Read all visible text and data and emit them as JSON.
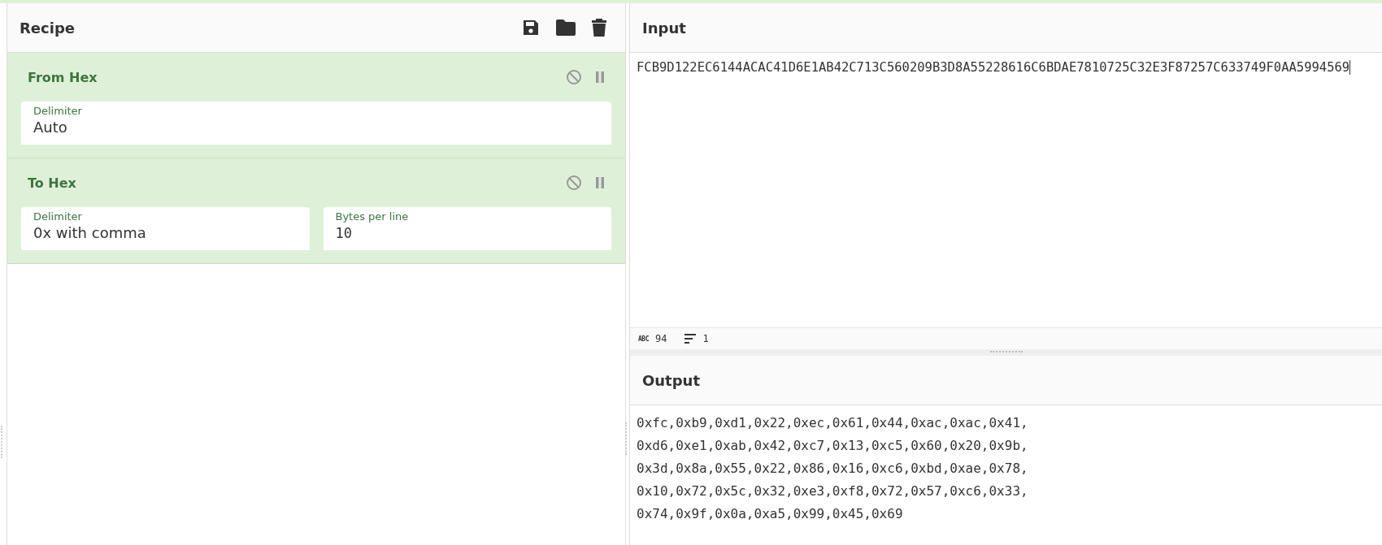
{
  "recipe": {
    "title": "Recipe",
    "operations": [
      {
        "name": "From Hex",
        "args": [
          {
            "label": "Delimiter",
            "value": "Auto",
            "kind": "text"
          }
        ]
      },
      {
        "name": "To Hex",
        "args": [
          {
            "label": "Delimiter",
            "value": "0x with comma",
            "kind": "text"
          },
          {
            "label": "Bytes per line",
            "value": "10",
            "kind": "number"
          }
        ]
      }
    ]
  },
  "input": {
    "title": "Input",
    "text": "FCB9D122EC6144ACAC41D6E1AB42C713C560209B3D8A55228616C6BDAE7810725C32E3F87257C633749F0AA5994569",
    "status": {
      "length_icon": "ABC",
      "length": "94",
      "lines": "1"
    }
  },
  "output": {
    "title": "Output",
    "lines": [
      "0xfc,0xb9,0xd1,0x22,0xec,0x61,0x44,0xac,0xac,0x41,",
      "0xd6,0xe1,0xab,0x42,0xc7,0x13,0xc5,0x60,0x20,0x9b,",
      "0x3d,0x8a,0x55,0x22,0x86,0x16,0xc6,0xbd,0xae,0x78,",
      "0x10,0x72,0x5c,0x32,0xe3,0xf8,0x72,0x57,0xc6,0x33,",
      "0x74,0x9f,0x0a,0xa5,0x99,0x45,0x69"
    ]
  }
}
